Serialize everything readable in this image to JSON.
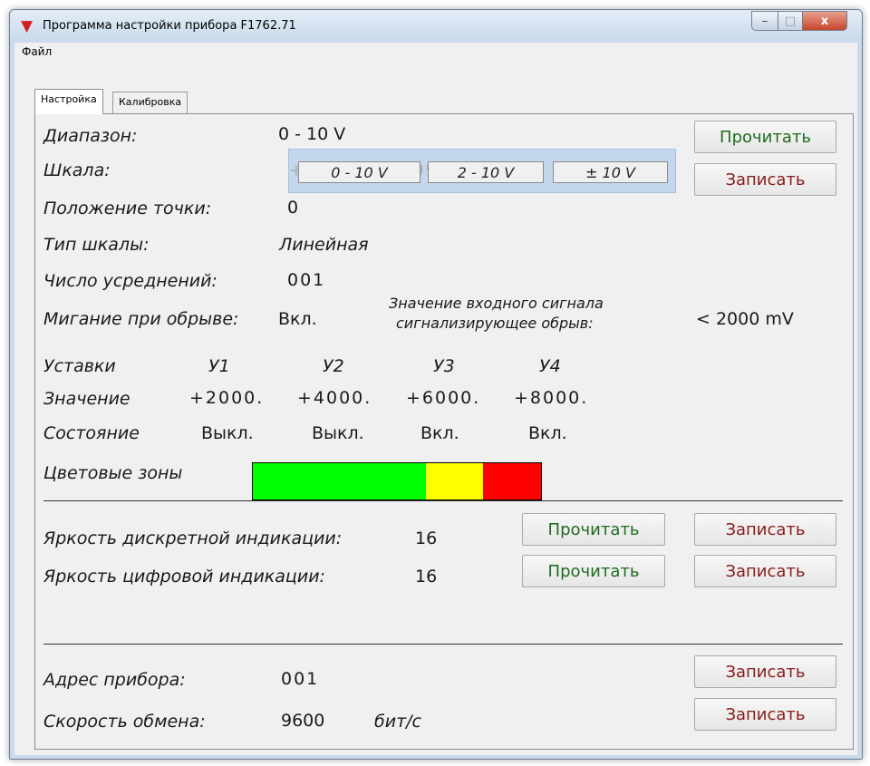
{
  "window": {
    "title": "Программа настройки прибора F1762.71",
    "icon": "v-logo-icon",
    "controls": {
      "minimize": "–",
      "maximize": "□",
      "close": "x"
    }
  },
  "menu": {
    "file": "Файл"
  },
  "tabs": {
    "settings": "Настройка",
    "calibration": "Калибровка"
  },
  "range": {
    "label": "Диапазон:",
    "value": "0 - 10 V"
  },
  "scale": {
    "label": "Шкала:",
    "ghost": "+0000.   +9999."
  },
  "scale_popup": {
    "options": [
      "0 - 10 V",
      "2 - 10 V",
      "± 10 V"
    ]
  },
  "decimal": {
    "label": "Положение точки:",
    "value": "0"
  },
  "scale_type": {
    "label": "Тип шкалы:",
    "value": "Линейная"
  },
  "averaging": {
    "label": "Число усреднений:",
    "value": "001"
  },
  "blink": {
    "label": "Мигание при обрыве:",
    "value": "Вкл.",
    "break_label_line1": "Значение входного сигнала",
    "break_label_line2": "сигнализирующее обрыв:",
    "break_value": "< 2000 mV"
  },
  "setpoints": {
    "header": "Уставки",
    "value_label": "Значение",
    "state_label": "Состояние",
    "names": [
      "У1",
      "У2",
      "У3",
      "У4"
    ],
    "values": [
      "+2000.",
      "+4000.",
      "+6000.",
      "+8000."
    ],
    "states": [
      "Выкл.",
      "Выкл.",
      "Вкл.",
      "Вкл."
    ]
  },
  "zones": {
    "label": "Цветовые зоны",
    "segments": [
      {
        "fraction": 0.6,
        "color": "#00ff00"
      },
      {
        "fraction": 0.2,
        "color": "#ffff00"
      },
      {
        "fraction": 0.2,
        "color": "#ff0000"
      }
    ]
  },
  "brightness": {
    "discrete_label": "Яркость дискретной индикации:",
    "discrete_value": "16",
    "digital_label": "Яркость цифровой индикации:",
    "digital_value": "16"
  },
  "device": {
    "address_label": "Адрес прибора:",
    "address_value": "001",
    "baud_label": "Скорость обмена:",
    "baud_value": "9600",
    "baud_unit": "бит/с"
  },
  "buttons": {
    "read": "Прочитать",
    "write": "Записать"
  },
  "colors": {
    "read_text": "#1e6b1e",
    "write_text": "#8a1a1a"
  }
}
